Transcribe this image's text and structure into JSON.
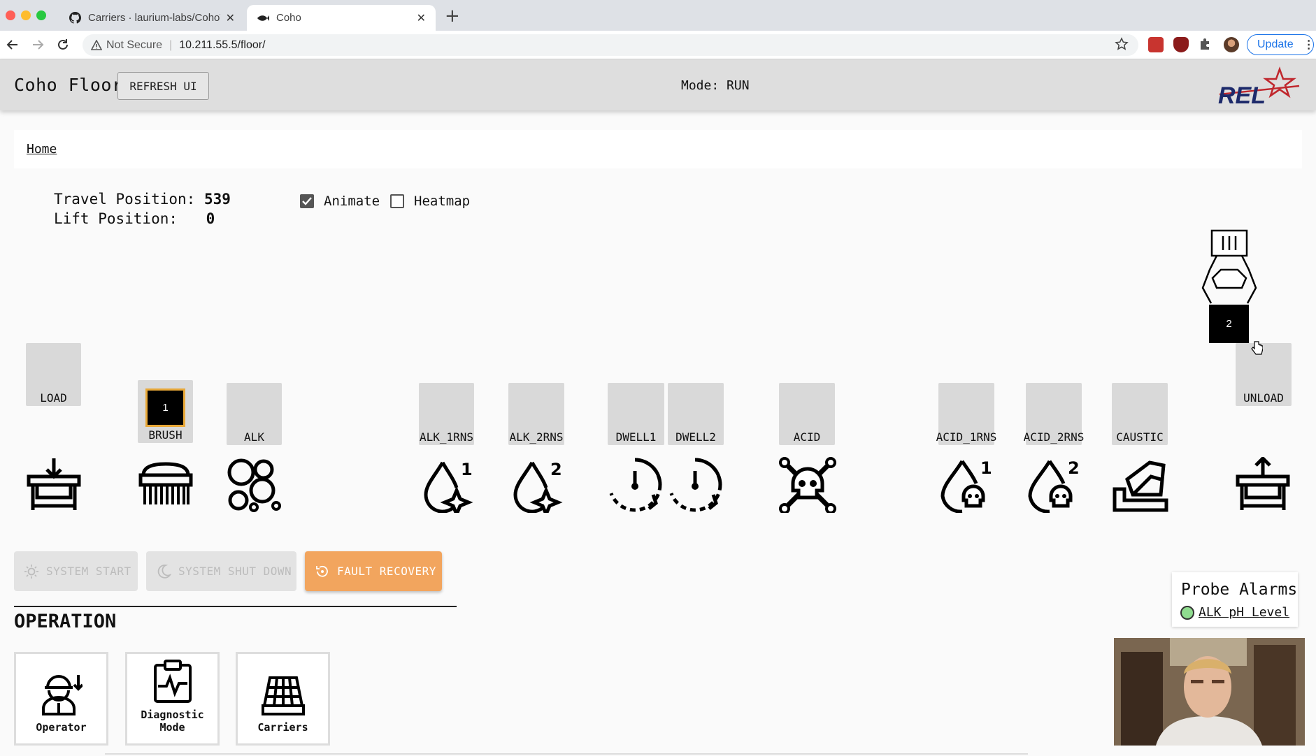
{
  "browser": {
    "tabs": [
      {
        "title": "Carriers · laurium-labs/CohoWi",
        "active": false
      },
      {
        "title": "Coho",
        "active": true
      }
    ],
    "new_tab": "+",
    "security_label": "Not Secure",
    "url": "10.211.55.5/floor/",
    "update_label": "Update",
    "colors": {
      "close": "#ff5f57",
      "minimize": "#febc2e",
      "maximize": "#28c840"
    }
  },
  "app": {
    "title": "Coho Floor",
    "refresh_label": "REFRESH UI",
    "mode": "Mode: RUN",
    "logo_text": "REL",
    "logo_color": "#c0272d",
    "breadcrumb": "Home"
  },
  "positions": {
    "travel_label": "Travel Position:",
    "travel_value": "539",
    "lift_label": "Lift Position:",
    "lift_value": "0"
  },
  "toggles": {
    "animate": {
      "label": "Animate",
      "checked": true
    },
    "heatmap": {
      "label": "Heatmap",
      "checked": false
    }
  },
  "stations": [
    {
      "label": "LOAD",
      "icon": "load-table-icon"
    },
    {
      "label": "BRUSH",
      "icon": "brush-icon",
      "carrier": "1"
    },
    {
      "label": "ALK",
      "icon": "bubbles-icon"
    },
    {
      "label": "ALK_1RNS",
      "icon": "rinse-1-icon"
    },
    {
      "label": "ALK_2RNS",
      "icon": "rinse-2-icon"
    },
    {
      "label": "DWELL1",
      "icon": "timer-icon"
    },
    {
      "label": "DWELL2",
      "icon": "timer-icon"
    },
    {
      "label": "ACID",
      "icon": "skull-crossbones-icon"
    },
    {
      "label": "ACID_1RNS",
      "icon": "acid-rinse-1-icon"
    },
    {
      "label": "ACID_2RNS",
      "icon": "acid-rinse-2-icon"
    },
    {
      "label": "CAUSTIC",
      "icon": "caustic-icon"
    },
    {
      "label": "UNLOAD",
      "icon": "unload-table-icon"
    }
  ],
  "hoist": {
    "carrier": "2",
    "icon": "hoist-gripper-icon"
  },
  "system_buttons": {
    "start": "SYSTEM START",
    "shutdown": "SYSTEM SHUT DOWN",
    "fault": "FAULT RECOVERY",
    "fault_color": "#f2a55e"
  },
  "operation": {
    "heading": "OPERATION",
    "cards": [
      {
        "label": "Operator",
        "icon": "operator-icon"
      },
      {
        "label": "Diagnostic Mode",
        "icon": "clipboard-pulse-icon"
      },
      {
        "label": "Carriers",
        "icon": "carrier-rack-icon"
      }
    ]
  },
  "probe_alarms": {
    "title": "Probe Alarms",
    "items": [
      {
        "label": "ALK pH Level",
        "status_color": "#8fdc8f"
      }
    ]
  }
}
